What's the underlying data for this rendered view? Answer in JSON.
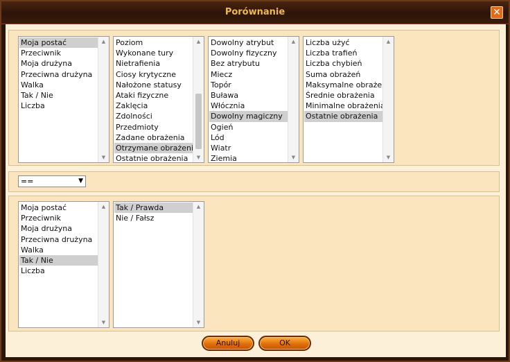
{
  "window": {
    "title": "Porównanie",
    "close_glyph": "✕"
  },
  "lists_top": [
    {
      "items": [
        "Moja postać",
        "Przeciwnik",
        "Moja drużyna",
        "Przeciwna drużyna",
        "Walka",
        "Tak / Nie",
        "Liczba"
      ],
      "selected": 0
    },
    {
      "items": [
        "Poziom",
        "Wykonane tury",
        "Nietrafienia",
        "Ciosy krytyczne",
        "Nałożone statusy",
        "Ataki fizyczne",
        "Zaklęcia",
        "Zdolności",
        "Przedmioty",
        "Zadane obrażenia",
        "Otrzymane obrażenia",
        "Ostatnie obrażenia"
      ],
      "selected": 10
    },
    {
      "items": [
        "Dowolny atrybut",
        "Dowolny fizyczny",
        "Bez atrybutu",
        "Miecz",
        "Topór",
        "Buława",
        "Włócznia",
        "Dowolny magiczny",
        "Ogień",
        "Lód",
        "Wiatr",
        "Ziemia"
      ],
      "selected": 7
    },
    {
      "items": [
        "Liczba użyć",
        "Liczba trafień",
        "Liczba chybień",
        "Suma obrażeń",
        "Maksymalne obrażenia",
        "Średnie obrażenia",
        "Minimalne obrażenia",
        "Ostatnie obrażenia"
      ],
      "selected": 7
    }
  ],
  "operator": {
    "value": "==",
    "arrow": "▼"
  },
  "lists_bottom": [
    {
      "items": [
        "Moja postać",
        "Przeciwnik",
        "Moja drużyna",
        "Przeciwna drużyna",
        "Walka",
        "Tak / Nie",
        "Liczba"
      ],
      "selected": 5
    },
    {
      "items": [
        "Tak / Prawda",
        "Nie / Fałsz"
      ],
      "selected": 0
    }
  ],
  "buttons": {
    "cancel": "Anuluj",
    "ok": "OK"
  }
}
